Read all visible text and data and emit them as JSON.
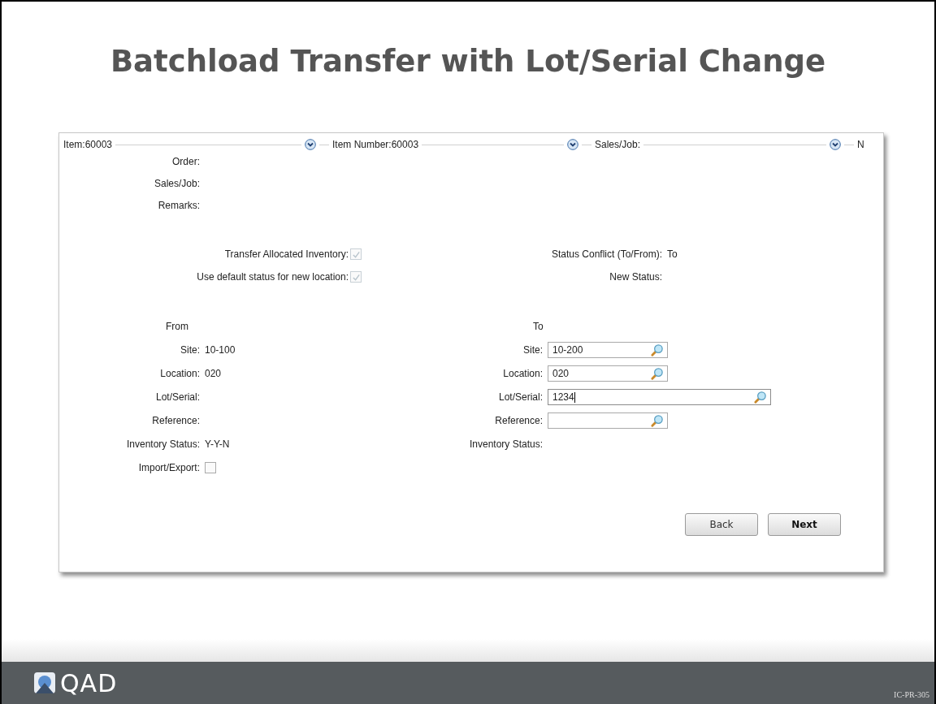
{
  "slide_title": "Batchload Transfer with Lot/Serial Change",
  "header_segments": [
    {
      "label": "Item:60003"
    },
    {
      "label": "Item Number:60003"
    },
    {
      "label": "Sales/Job:"
    }
  ],
  "header_cut_text": "N",
  "info_fields": [
    {
      "label": "Order:"
    },
    {
      "label": "Sales/Job:"
    },
    {
      "label": "Remarks:"
    }
  ],
  "options": [
    {
      "label": "Transfer Allocated Inventory:",
      "checked": true,
      "disabled": true
    },
    {
      "label": "Use default status for new location:",
      "checked": true,
      "disabled": true
    }
  ],
  "status_fields": [
    {
      "label": "Status Conflict (To/From):",
      "value": "To"
    },
    {
      "label": "New Status:"
    }
  ],
  "from": {
    "heading": "From",
    "fields": [
      {
        "kind": "text",
        "label": "Site:",
        "value": "10-100"
      },
      {
        "kind": "text",
        "label": "Location:",
        "value": "020"
      },
      {
        "kind": "text",
        "label": "Lot/Serial:"
      },
      {
        "kind": "text",
        "label": "Reference:"
      },
      {
        "kind": "text",
        "label": "Inventory Status:",
        "value": "Y-Y-N"
      },
      {
        "kind": "checkbox",
        "label": "Import/Export:",
        "checked": false,
        "disabled": false
      }
    ]
  },
  "to": {
    "heading": "To",
    "fields": [
      {
        "kind": "lookup",
        "label": "Site:",
        "value": "10-200",
        "wide": false,
        "focused": false
      },
      {
        "kind": "lookup",
        "label": "Location:",
        "value": "020",
        "wide": false,
        "focused": false
      },
      {
        "kind": "lookup",
        "label": "Lot/Serial:",
        "value": "1234",
        "wide": true,
        "focused": true
      },
      {
        "kind": "lookup",
        "label": "Reference:",
        "wide": false,
        "focused": false
      },
      {
        "kind": "text",
        "label": "Inventory Status:"
      }
    ]
  },
  "buttons": [
    {
      "label": "Back",
      "default": false
    },
    {
      "label": "Next",
      "default": true
    }
  ],
  "footer": {
    "logo_text": "QAD",
    "slide_code": "IC-PR-305"
  }
}
